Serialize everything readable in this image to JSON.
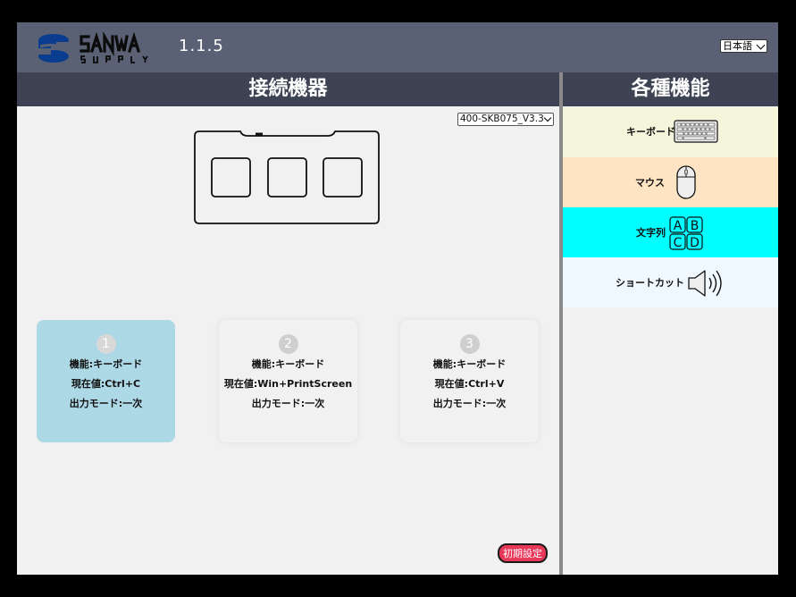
{
  "header": {
    "logo_text": "SANWA SUPPLY",
    "version": "1.1.5",
    "language": "日本語"
  },
  "left_panel": {
    "title": "接続機器",
    "model": "400-SKB075_V3.3"
  },
  "right_panel": {
    "title": "各種機能"
  },
  "keys": [
    {
      "number": "1",
      "function": "機能:キーボード",
      "value": "現在値:Ctrl+C",
      "mode": "出力モード:一次",
      "selected": true
    },
    {
      "number": "2",
      "function": "機能:キーボード",
      "value": "現在値:Win+PrintScreen",
      "mode": "出力モード:一次",
      "selected": false
    },
    {
      "number": "3",
      "function": "機能:キーボード",
      "value": "現在値:Ctrl+V",
      "mode": "出力モード:一次",
      "selected": false
    }
  ],
  "functions": [
    {
      "label": "キーボード",
      "icon": "keyboard-icon",
      "bg": "#f5f5dc"
    },
    {
      "label": "マウス",
      "icon": "mouse-icon",
      "bg": "#ffe4c4"
    },
    {
      "label": "文字列",
      "icon": "abcd-icon",
      "bg": "#00ffff"
    },
    {
      "label": "ショートカット",
      "icon": "speaker-icon",
      "bg": "#f0f8ff"
    }
  ],
  "reset_button": "初期設定",
  "colors": {
    "topbar": "#5b6174",
    "section_header": "#3d4353",
    "selected_card": "#add8e6",
    "reset_button": "#e8385a"
  }
}
